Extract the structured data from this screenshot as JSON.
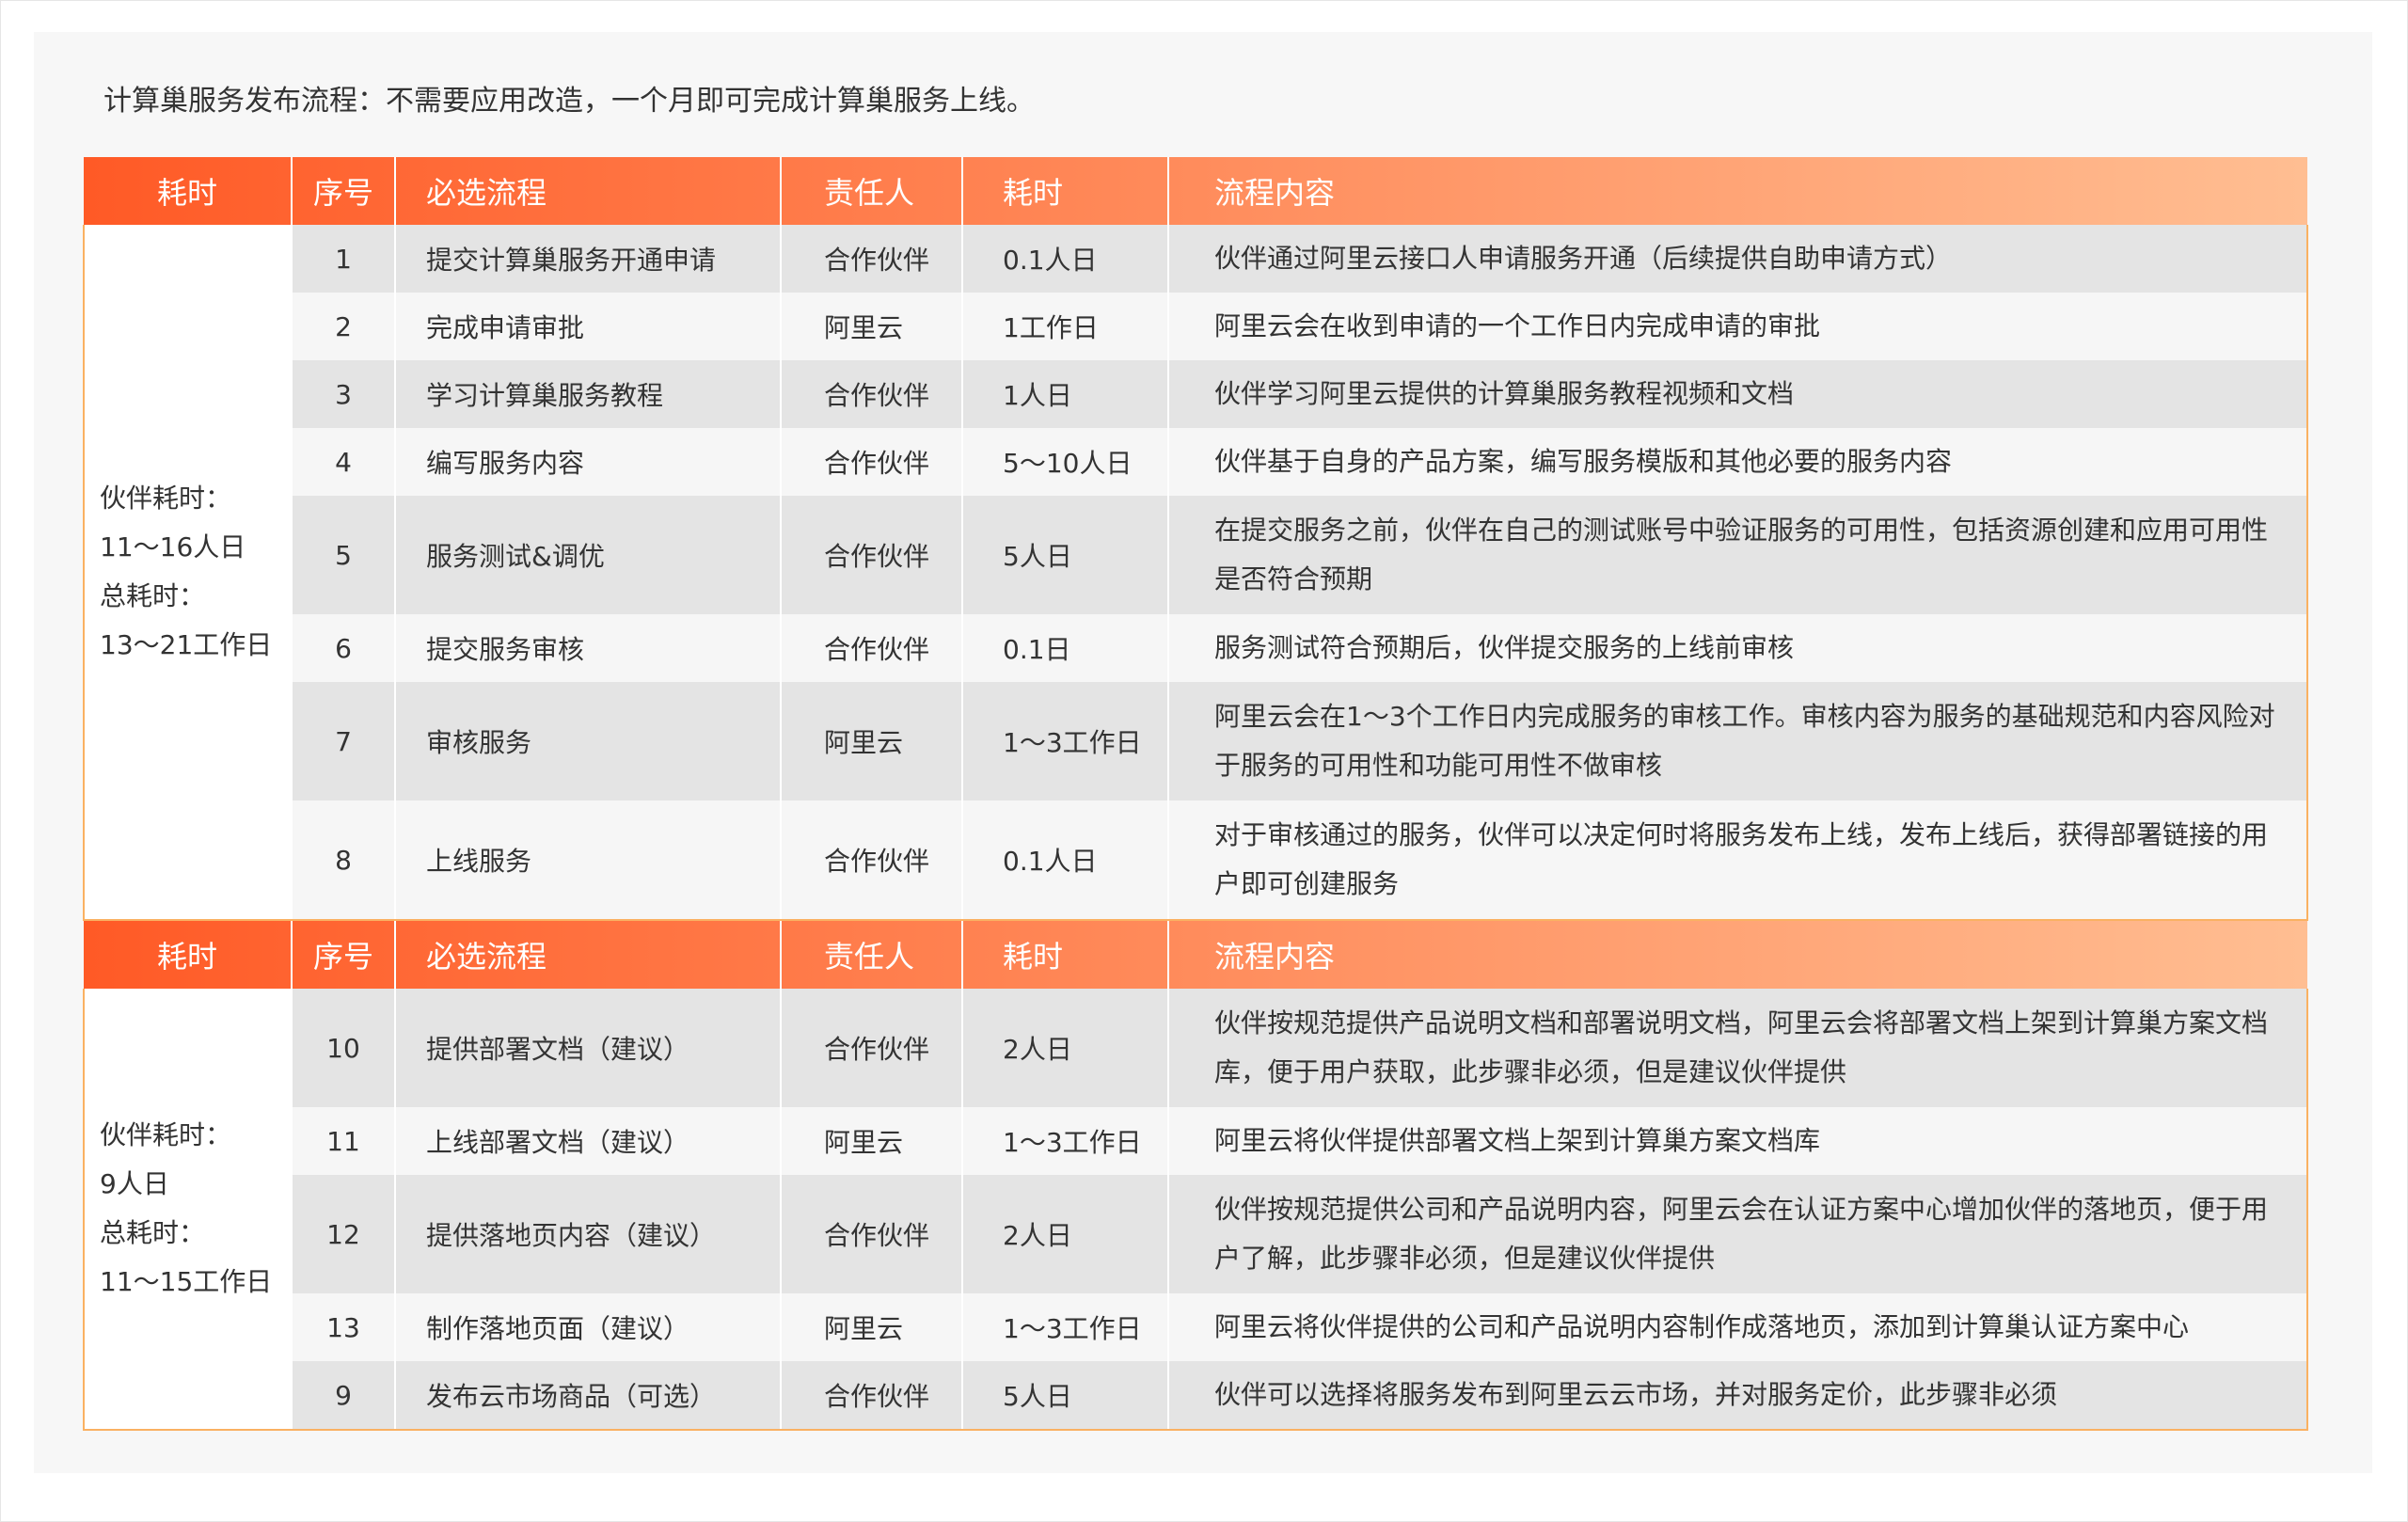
{
  "intro": "计算巢服务发布流程：不需要应用改造，一个月即可完成计算巢服务上线。",
  "colors": {
    "header_gradient_start": "#ff5a26",
    "header_gradient_end": "#ffbe92",
    "border_accent": "#fab162",
    "row_shade": "#e4e4e4",
    "row_light": "#f6f6f6"
  },
  "header": {
    "elapsed": "耗时",
    "no": "序号",
    "step": "必选流程",
    "owner": "责任人",
    "time": "耗时",
    "desc": "流程内容"
  },
  "sections": [
    {
      "elapsed_lines": [
        "伙伴耗时：",
        "11～16人日",
        "总耗时：",
        "13～21工作日"
      ],
      "rows": [
        {
          "no": "1",
          "step": "提交计算巢服务开通申请",
          "owner": "合作伙伴",
          "time": "0.1人日",
          "desc": "伙伴通过阿里云接口人申请服务开通（后续提供自助申请方式）",
          "tall": false
        },
        {
          "no": "2",
          "step": "完成申请审批",
          "owner": "阿里云",
          "time": "1工作日",
          "desc": "阿里云会在收到申请的一个工作日内完成申请的审批",
          "tall": false
        },
        {
          "no": "3",
          "step": "学习计算巢服务教程",
          "owner": "合作伙伴",
          "time": "1人日",
          "desc": "伙伴学习阿里云提供的计算巢服务教程视频和文档",
          "tall": false
        },
        {
          "no": "4",
          "step": "编写服务内容",
          "owner": "合作伙伴",
          "time": "5～10人日",
          "desc": "伙伴基于自身的产品方案，编写服务模版和其他必要的服务内容",
          "tall": false
        },
        {
          "no": "5",
          "step": "服务测试&调优",
          "owner": "合作伙伴",
          "time": "5人日",
          "desc": "在提交服务之前，伙伴在自己的测试账号中验证服务的可用性，包括资源创建和应用可用性是否符合预期",
          "tall": true
        },
        {
          "no": "6",
          "step": "提交服务审核",
          "owner": "合作伙伴",
          "time": "0.1日",
          "desc": "服务测试符合预期后，伙伴提交服务的上线前审核",
          "tall": false
        },
        {
          "no": "7",
          "step": "审核服务",
          "owner": "阿里云",
          "time": "1～3工作日",
          "desc": "阿里云会在1～3个工作日内完成服务的审核工作。审核内容为服务的基础规范和内容风险对于服务的可用性和功能可用性不做审核",
          "tall": true
        },
        {
          "no": "8",
          "step": "上线服务",
          "owner": "合作伙伴",
          "time": "0.1人日",
          "desc": "对于审核通过的服务，伙伴可以决定何时将服务发布上线，发布上线后，获得部署链接的用户即可创建服务",
          "tall": true
        }
      ]
    },
    {
      "elapsed_lines": [
        "伙伴耗时：",
        "9人日",
        "总耗时：",
        "11～15工作日"
      ],
      "rows": [
        {
          "no": "10",
          "step": "提供部署文档（建议）",
          "owner": "合作伙伴",
          "time": "2人日",
          "desc": "伙伴按规范提供产品说明文档和部署说明文档，阿里云会将部署文档上架到计算巢方案文档库，便于用户获取，此步骤非必须，但是建议伙伴提供",
          "tall": true
        },
        {
          "no": "11",
          "step": "上线部署文档（建议）",
          "owner": "阿里云",
          "time": "1～3工作日",
          "desc": "阿里云将伙伴提供部署文档上架到计算巢方案文档库",
          "tall": false
        },
        {
          "no": "12",
          "step": "提供落地页内容（建议）",
          "owner": "合作伙伴",
          "time": "2人日",
          "desc": "伙伴按规范提供公司和产品说明内容，阿里云会在认证方案中心增加伙伴的落地页，便于用户了解，此步骤非必须，但是建议伙伴提供",
          "tall": true
        },
        {
          "no": "13",
          "step": "制作落地页面（建议）",
          "owner": "阿里云",
          "time": "1～3工作日",
          "desc": "阿里云将伙伴提供的公司和产品说明内容制作成落地页，添加到计算巢认证方案中心",
          "tall": false
        },
        {
          "no": "9",
          "step": "发布云市场商品（可选）",
          "owner": "合作伙伴",
          "time": "5人日",
          "desc": "伙伴可以选择将服务发布到阿里云云市场，并对服务定价，此步骤非必须",
          "tall": false
        }
      ]
    }
  ]
}
